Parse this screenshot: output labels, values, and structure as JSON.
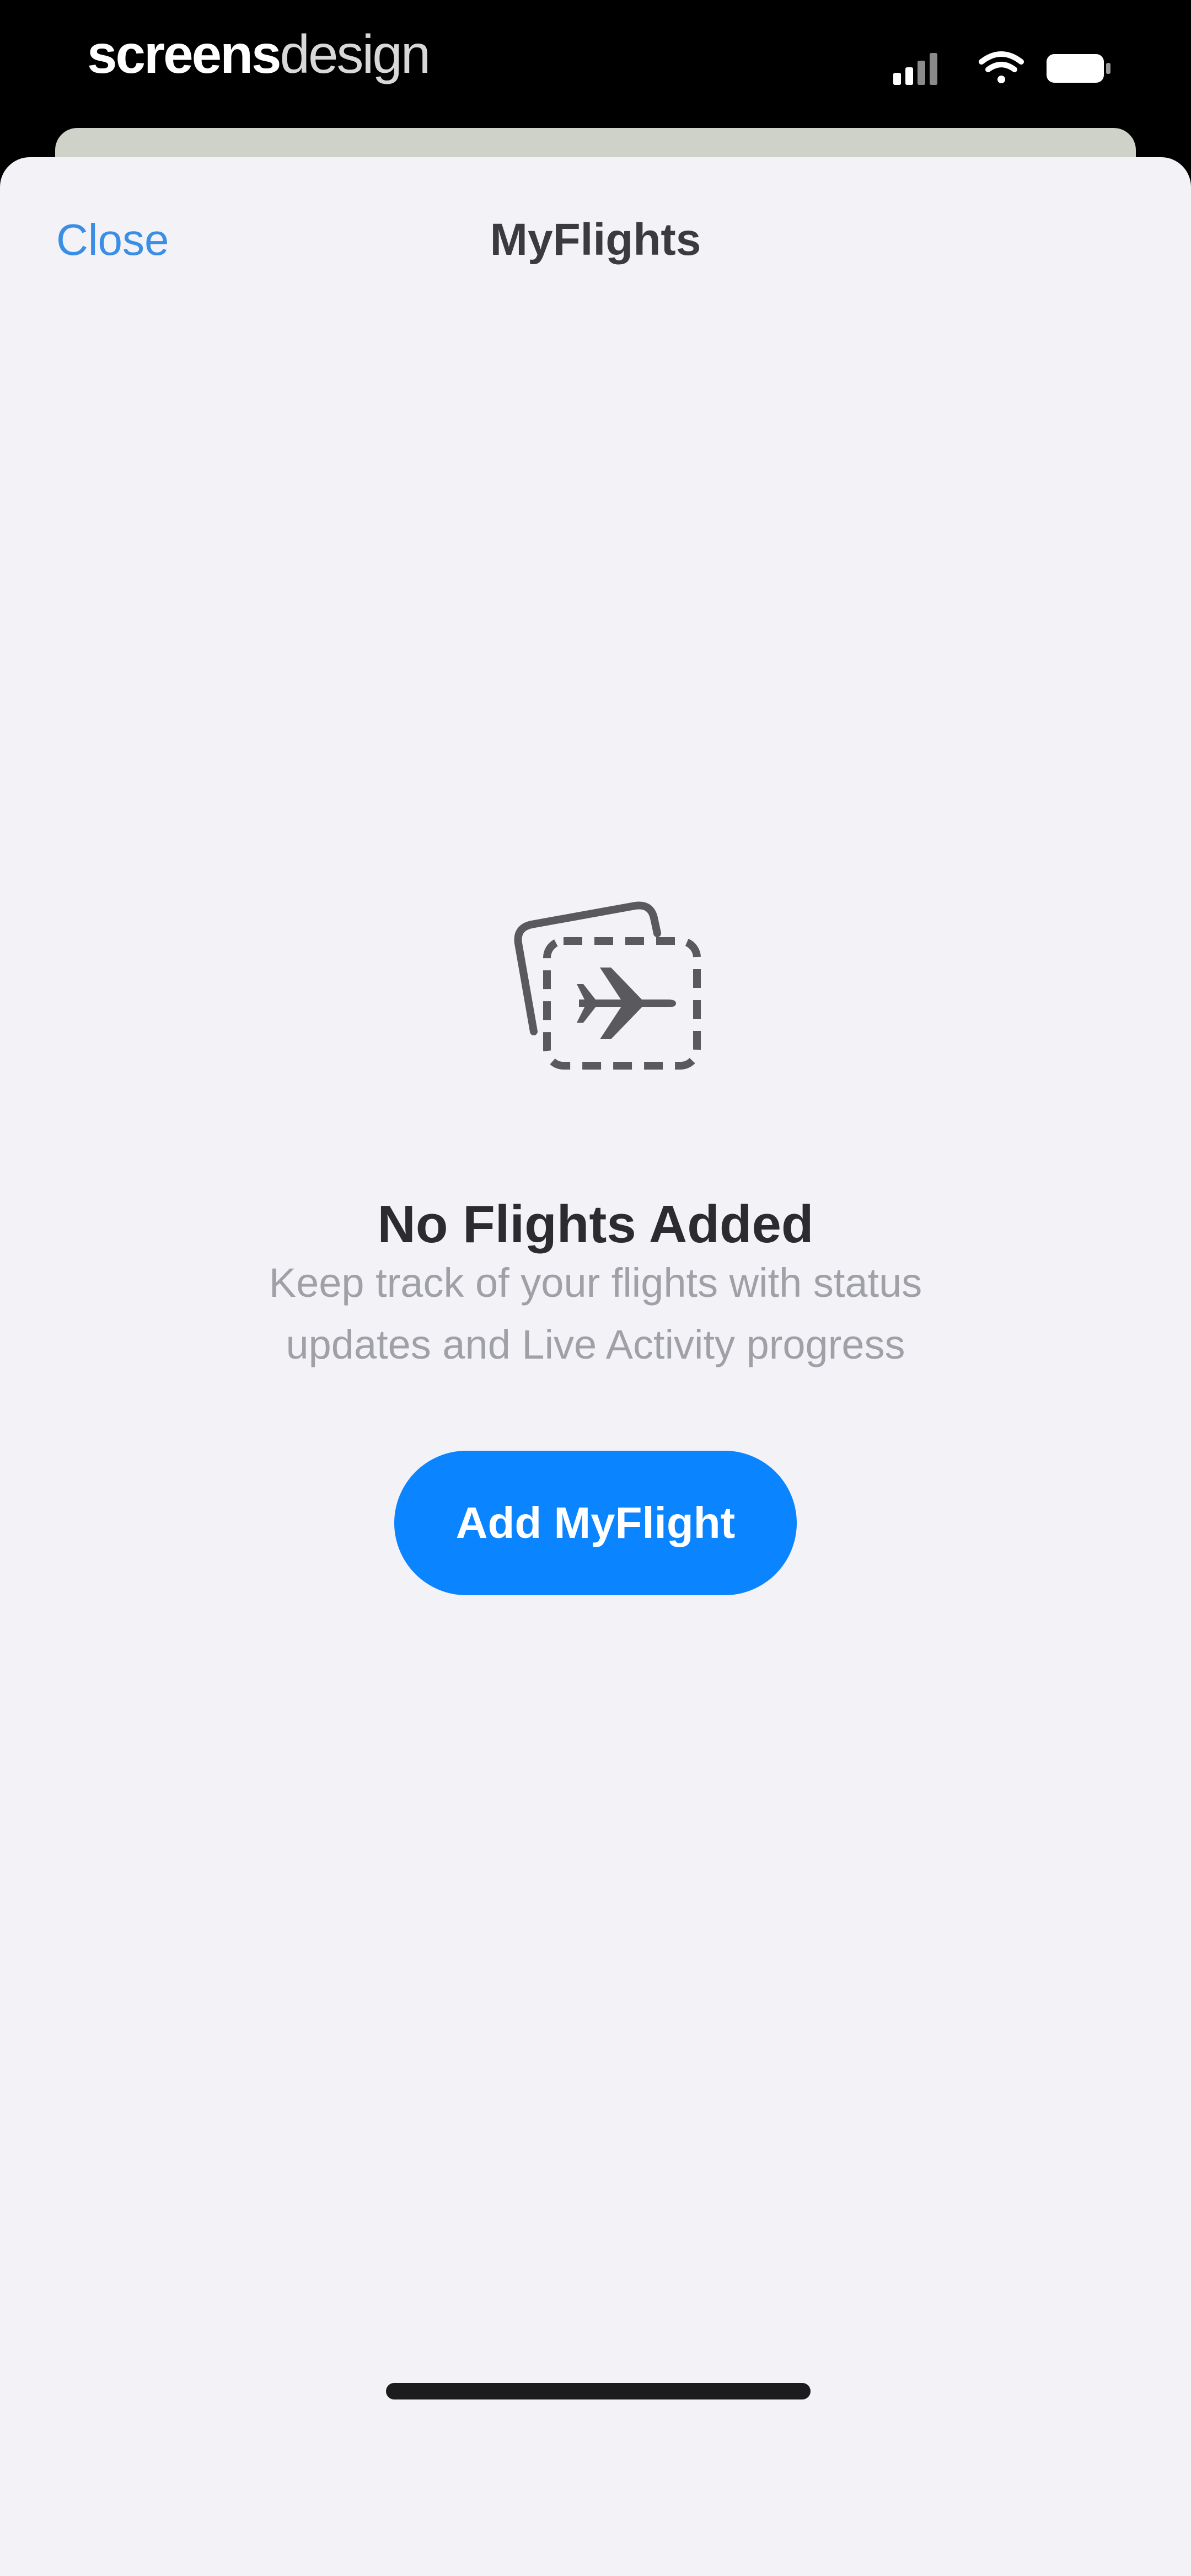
{
  "status_bar": {
    "brand_bold": "screens",
    "brand_light": "design",
    "icons": [
      "cellular-signal-icon",
      "wifi-icon",
      "battery-icon"
    ]
  },
  "sheet": {
    "close_label": "Close",
    "title": "MyFlights"
  },
  "empty_state": {
    "icon": "flight-card-icon",
    "title": "No Flights Added",
    "description_line1": "Keep track of your flights with status",
    "description_line2": "updates and Live Activity progress",
    "button_label": "Add MyFlight"
  },
  "colors": {
    "accent": "#0a84ff",
    "link": "#3a8ee6",
    "sheet_background": "#f2f2f7"
  }
}
